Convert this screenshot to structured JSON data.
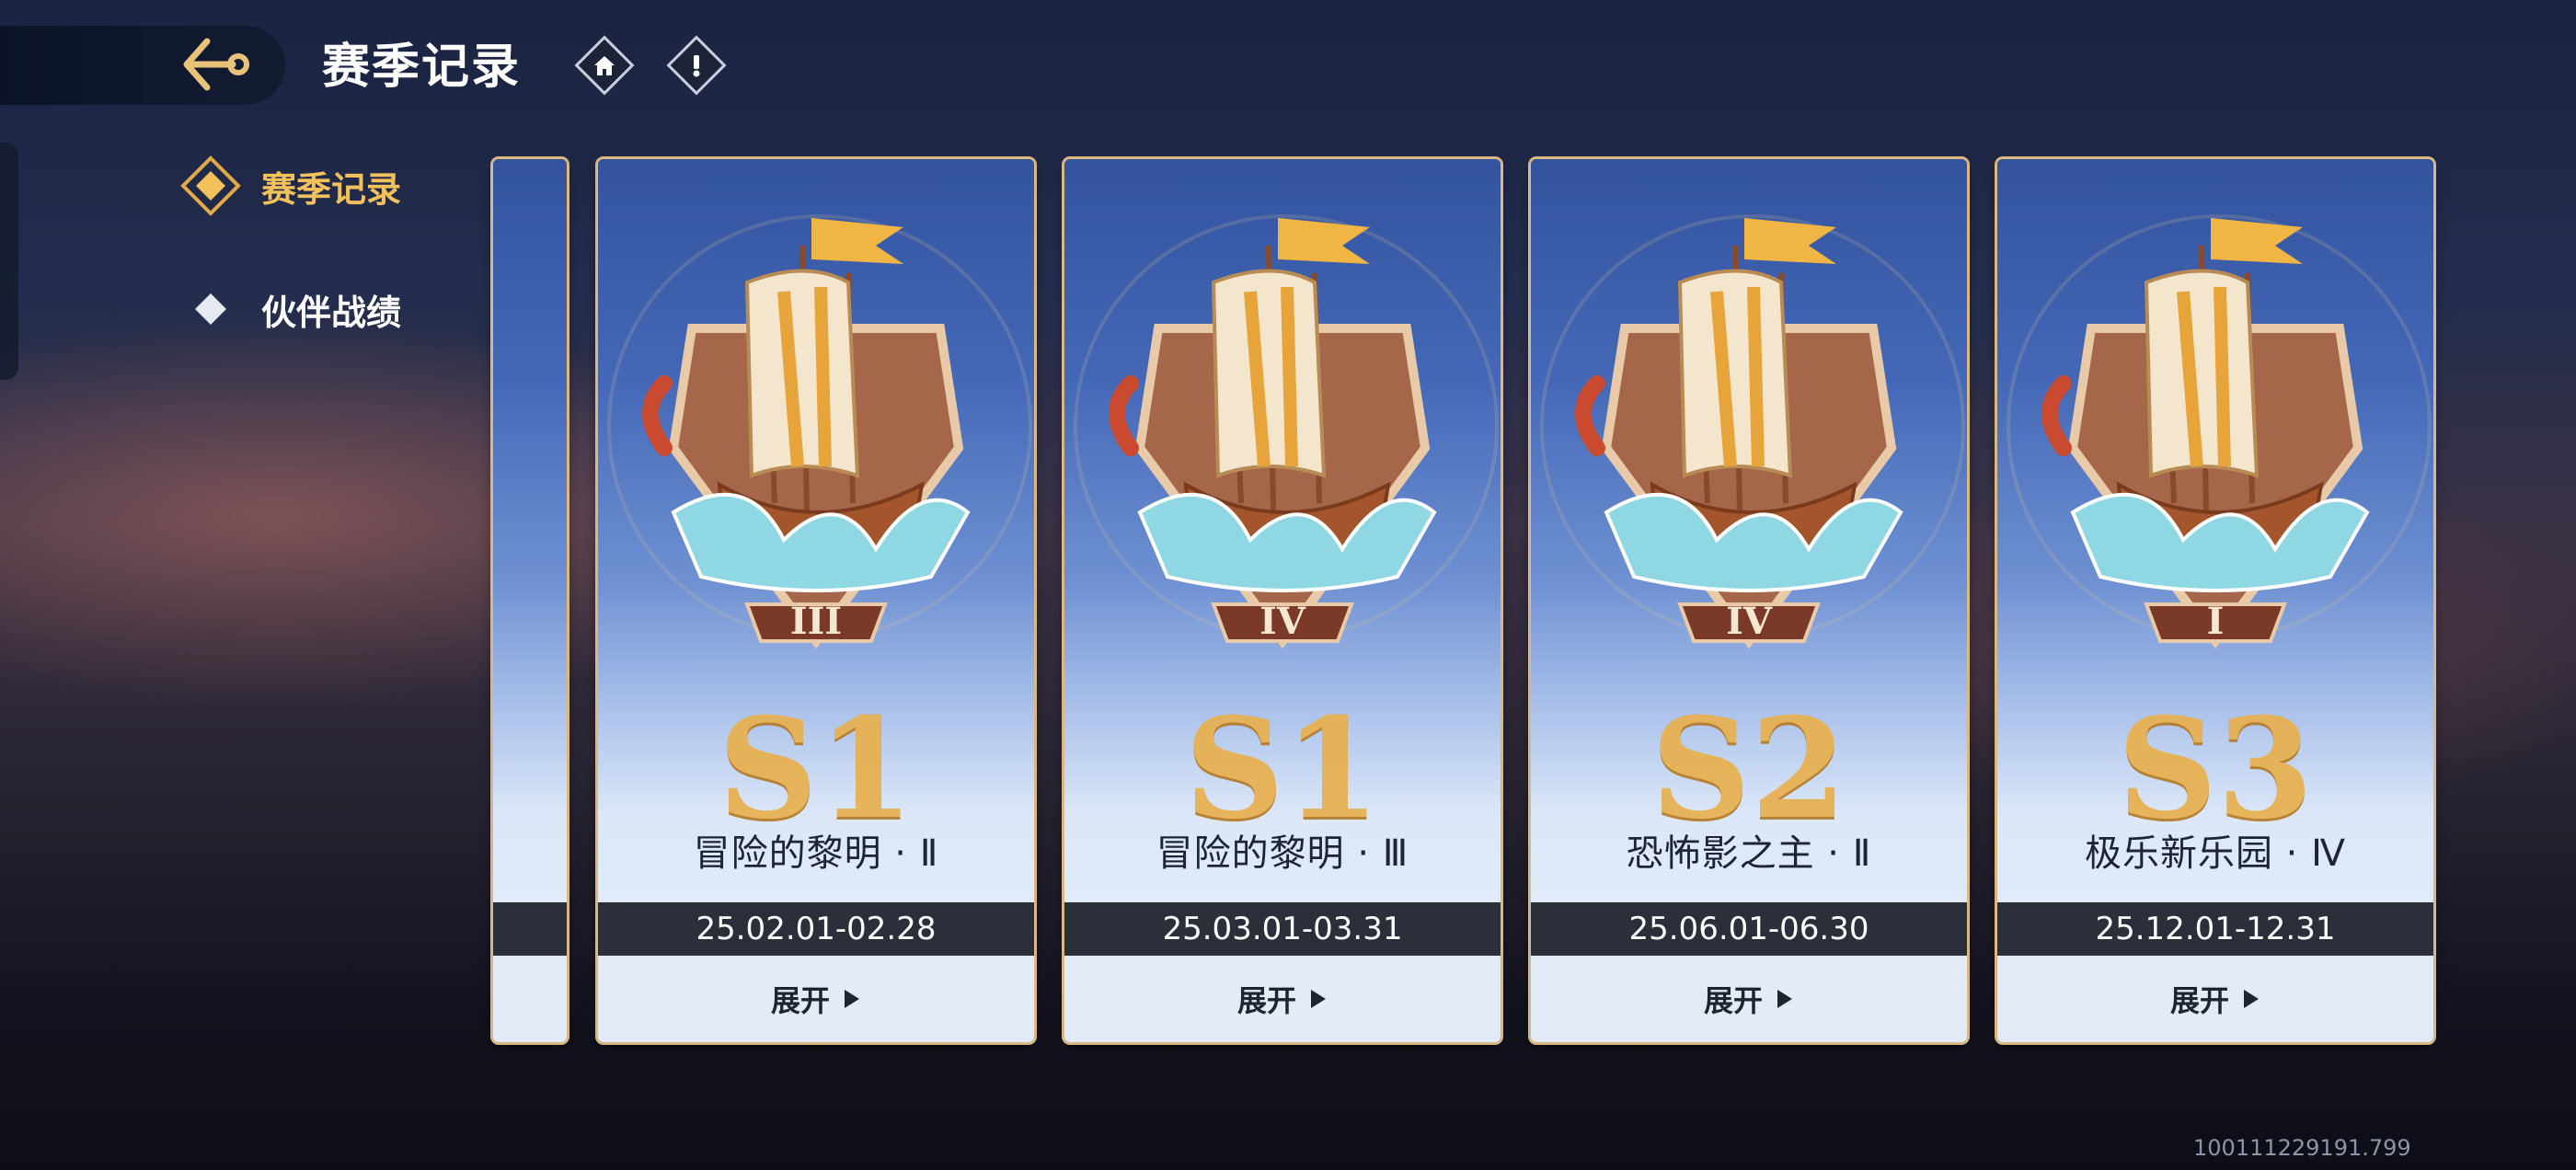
{
  "header": {
    "title": "赛季记录"
  },
  "nav": [
    {
      "label": "赛季记录",
      "active": true
    },
    {
      "label": "伙伴战绩",
      "active": false
    }
  ],
  "cards": [
    {
      "season": "S1",
      "rank": "III",
      "name": "冒险的黎明 · Ⅱ",
      "dates": "25.02.01-02.28",
      "expand": "展开"
    },
    {
      "season": "S1",
      "rank": "IV",
      "name": "冒险的黎明 · Ⅲ",
      "dates": "25.03.01-03.31",
      "expand": "展开"
    },
    {
      "season": "S2",
      "rank": "IV",
      "name": "恐怖影之主 · Ⅱ",
      "dates": "25.06.01-06.30",
      "expand": "展开"
    },
    {
      "season": "S3",
      "rank": "I",
      "name": "极乐新乐园 · Ⅳ",
      "dates": "25.12.01-12.31",
      "expand": "展开"
    }
  ],
  "footer": {
    "build_id": "100111229191.799"
  },
  "colors": {
    "accent": "#f3c15c",
    "card_gold": "#e8b04d",
    "date_bar": "#2a2f3a"
  }
}
